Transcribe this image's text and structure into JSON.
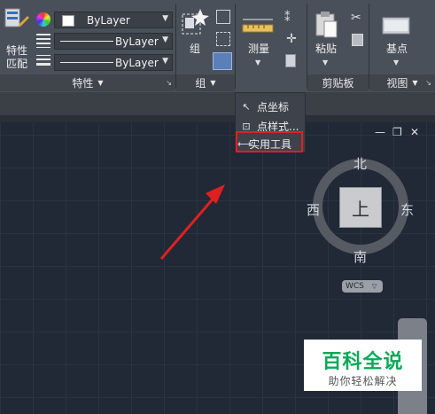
{
  "ribbon": {
    "properties_panel": {
      "match_label_line1": "特性",
      "match_label_line2": "匹配",
      "color_value": "ByLayer",
      "linetype_value": "ByLayer",
      "lineweight_value": "ByLayer",
      "panel_title": "特性"
    },
    "groups_panel": {
      "group_label": "组",
      "panel_title": "组"
    },
    "utilities_panel": {
      "measure_label": "测量"
    },
    "clipboard_panel": {
      "paste_label": "粘贴",
      "panel_title": "剪贴板"
    },
    "view_panel": {
      "basepoint_label": "基点",
      "panel_title": "视图"
    }
  },
  "dropdown_menu": {
    "items": [
      {
        "label": "点坐标",
        "icon": "point-coordinate-icon"
      },
      {
        "label": "点样式...",
        "icon": "point-style-icon"
      },
      {
        "label": "实用工具",
        "icon": "measure-tool-icon"
      }
    ]
  },
  "viewcube": {
    "north": "北",
    "south": "南",
    "east": "东",
    "west": "西",
    "face": "上",
    "wcs_label": "WCS"
  },
  "watermark": {
    "title": "百科全说",
    "subtitle": "助你轻松解决"
  },
  "colors": {
    "ribbon_bg": "#4a505a",
    "canvas_bg": "#212836",
    "highlight": "#e02020",
    "arrow": "#e02020",
    "watermark_text": "#0aa858"
  }
}
